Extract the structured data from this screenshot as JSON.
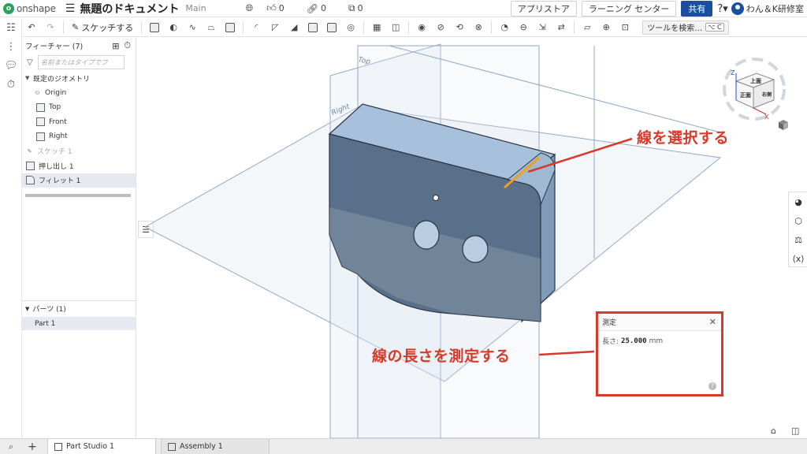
{
  "app": {
    "logo_text": "onshape",
    "doc_title": "無題のドキュメント",
    "branch": "Main",
    "likes": "0",
    "links": "0",
    "copies": "0",
    "buttons": {
      "app_store": "アプリストア",
      "learning": "ラーニング センター",
      "share": "共有"
    },
    "user_name": "わん＆K研修室"
  },
  "toolbar": {
    "sketch_label": "スケッチする",
    "search_label": "ツールを検索…",
    "search_shortcut": "⌥ C"
  },
  "features": {
    "header": "フィーチャー (7)",
    "filter_placeholder": "名前またはタイプでフ",
    "default_geometry": "既定のジオメトリ",
    "origin": "Origin",
    "top": "Top",
    "front": "Front",
    "right": "Right",
    "sketch": "スケッチ 1",
    "extrude": "押し出し 1",
    "fillet": "フィレット 1"
  },
  "parts": {
    "header": "パーツ (1)",
    "item": "Part 1"
  },
  "viewport": {
    "plane_top": "Top",
    "plane_right": "Right"
  },
  "viewcube": {
    "axis_z": "Z",
    "axis_x": "X",
    "face_top": "上面",
    "face_front": "正面",
    "face_right": "右側"
  },
  "measure": {
    "title": "測定",
    "length_label": "長さ:",
    "length_value": "25.000",
    "unit": "mm"
  },
  "annotations": {
    "select_line": "線を選択する",
    "measure_line": "線の長さを測定する"
  },
  "tabs": {
    "part_studio": "Part Studio 1",
    "assembly": "Assembly 1"
  },
  "colors": {
    "accent": "#1a4fa0",
    "annotation": "#d63a2b",
    "part_face": "#7f97b0",
    "edge_highlight": "#f0a020"
  }
}
